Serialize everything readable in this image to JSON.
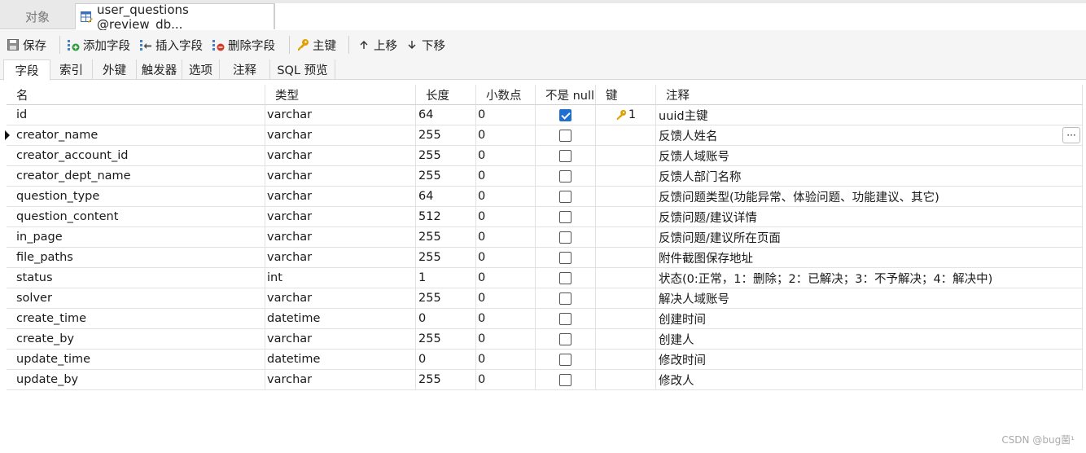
{
  "tabs": {
    "inactive_label": "对象",
    "active_label": "user_questions @review_db..."
  },
  "toolbar": {
    "save": "保存",
    "add_field": "添加字段",
    "insert_field": "插入字段",
    "delete_field": "删除字段",
    "primary_key": "主键",
    "move_up": "上移",
    "move_down": "下移"
  },
  "subtabs": [
    "字段",
    "索引",
    "外键",
    "触发器",
    "选项",
    "注释",
    "SQL 预览"
  ],
  "columns": {
    "name": "名",
    "type": "类型",
    "length": "长度",
    "decimal": "小数点",
    "not_null": "不是 null",
    "key": "键",
    "comment": "注释"
  },
  "rows": [
    {
      "name": "id",
      "type": "varchar",
      "length": "64",
      "decimal": "0",
      "not_null": true,
      "key": "1",
      "comment": "uuid主键"
    },
    {
      "name": "creator_name",
      "type": "varchar",
      "length": "255",
      "decimal": "0",
      "not_null": false,
      "key": "",
      "comment": "反馈人姓名"
    },
    {
      "name": "creator_account_id",
      "type": "varchar",
      "length": "255",
      "decimal": "0",
      "not_null": false,
      "key": "",
      "comment": "反馈人域账号"
    },
    {
      "name": "creator_dept_name",
      "type": "varchar",
      "length": "255",
      "decimal": "0",
      "not_null": false,
      "key": "",
      "comment": "反馈人部门名称"
    },
    {
      "name": "question_type",
      "type": "varchar",
      "length": "64",
      "decimal": "0",
      "not_null": false,
      "key": "",
      "comment": "反馈问题类型(功能异常、体验问题、功能建议、其它)"
    },
    {
      "name": "question_content",
      "type": "varchar",
      "length": "512",
      "decimal": "0",
      "not_null": false,
      "key": "",
      "comment": "反馈问题/建议详情"
    },
    {
      "name": "in_page",
      "type": "varchar",
      "length": "255",
      "decimal": "0",
      "not_null": false,
      "key": "",
      "comment": "反馈问题/建议所在页面"
    },
    {
      "name": "file_paths",
      "type": "varchar",
      "length": "255",
      "decimal": "0",
      "not_null": false,
      "key": "",
      "comment": "附件截图保存地址"
    },
    {
      "name": "status",
      "type": "int",
      "length": "1",
      "decimal": "0",
      "not_null": false,
      "key": "",
      "comment": "状态(0:正常，1：删除；2：已解决；3：不予解决；4：解决中)"
    },
    {
      "name": "solver",
      "type": "varchar",
      "length": "255",
      "decimal": "0",
      "not_null": false,
      "key": "",
      "comment": "解决人域账号"
    },
    {
      "name": "create_time",
      "type": "datetime",
      "length": "0",
      "decimal": "0",
      "not_null": false,
      "key": "",
      "comment": "创建时间"
    },
    {
      "name": "create_by",
      "type": "varchar",
      "length": "255",
      "decimal": "0",
      "not_null": false,
      "key": "",
      "comment": "创建人"
    },
    {
      "name": "update_time",
      "type": "datetime",
      "length": "0",
      "decimal": "0",
      "not_null": false,
      "key": "",
      "comment": "修改时间"
    },
    {
      "name": "update_by",
      "type": "varchar",
      "length": "255",
      "decimal": "0",
      "not_null": false,
      "key": "",
      "comment": "修改人"
    }
  ],
  "ellipsis": "···",
  "watermark": "CSDN @bug菌¹",
  "colors": {
    "checkbox_checked": "#1f6fd0",
    "key_icon": "#e0a000"
  }
}
